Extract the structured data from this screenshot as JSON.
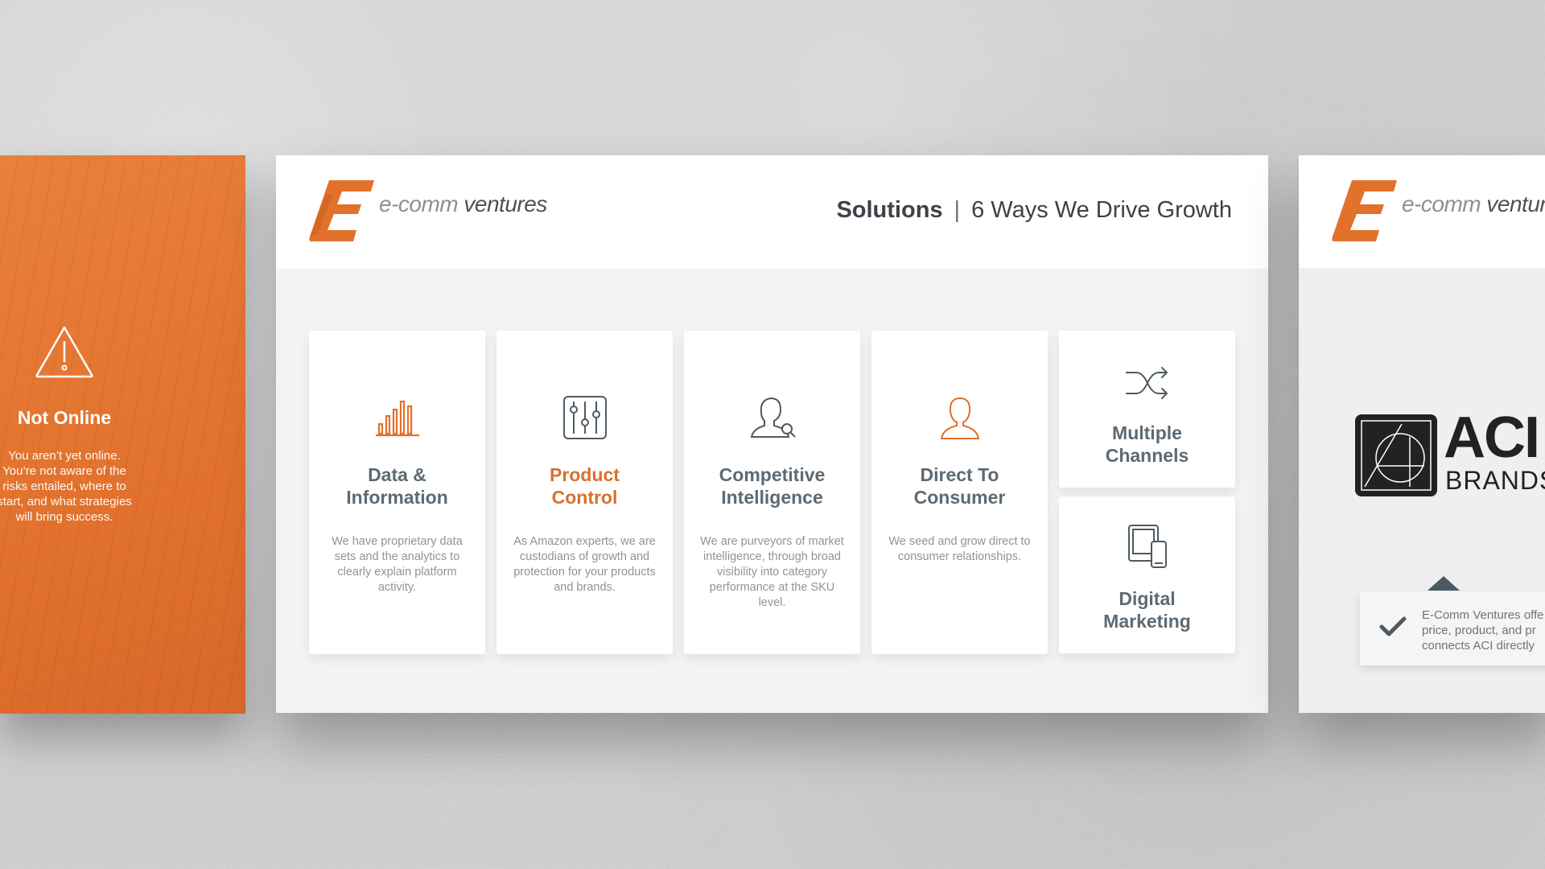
{
  "left_slide": {
    "title": "Not Online",
    "body": "You aren’t yet online. You’re not aware of the risks entailed, where to start, and what strategies will bring success.",
    "warning_icon": "warning-triangle-icon"
  },
  "main_slide": {
    "logo": {
      "text_light": "e-comm",
      "text_bold": " ventures",
      "icon": "ecomm-logo-icon"
    },
    "header": {
      "title_bold": "Solutions",
      "separator": "|",
      "title_rest": "6 Ways We Drive Growth"
    },
    "cards": [
      {
        "icon": "bar-chart-icon",
        "title_line1": "Data &",
        "title_line2": "Information",
        "description": "We have proprietary data sets and the analytics to clearly explain platform activity."
      },
      {
        "icon": "sliders-icon",
        "title_line1": "Product",
        "title_line2": "Control",
        "description": "As Amazon experts, we are custodians of growth and protection for your products and brands."
      },
      {
        "icon": "person-search-icon",
        "title_line1": "Competitive",
        "title_line2": "Intelligence",
        "description": "We are purveyors of market intelligence, through broad visibility into category performance at the SKU level."
      },
      {
        "icon": "person-icon",
        "title_line1": "Direct To",
        "title_line2": "Consumer",
        "description": "We seed and grow direct to consumer relationships."
      },
      {
        "icon": "shuffle-icon",
        "title_line1": "Multiple",
        "title_line2": "Channels"
      },
      {
        "icon": "devices-icon",
        "title_line1": "Digital",
        "title_line2": "Marketing"
      }
    ]
  },
  "right_slide": {
    "logo": {
      "text_light": "e-comm",
      "text_bold": " ventur"
    },
    "brand": {
      "text": "ACI",
      "sub": "BRANDS"
    },
    "callout": {
      "line1": "E-Comm Ventures offe",
      "line2": "price, product, and pr",
      "line3": "connects ACI directly"
    }
  },
  "colors": {
    "accent": "#e2712c",
    "text_dark": "#3b4248",
    "text_muted": "#8d949a",
    "card_title": "#5d6a73"
  }
}
